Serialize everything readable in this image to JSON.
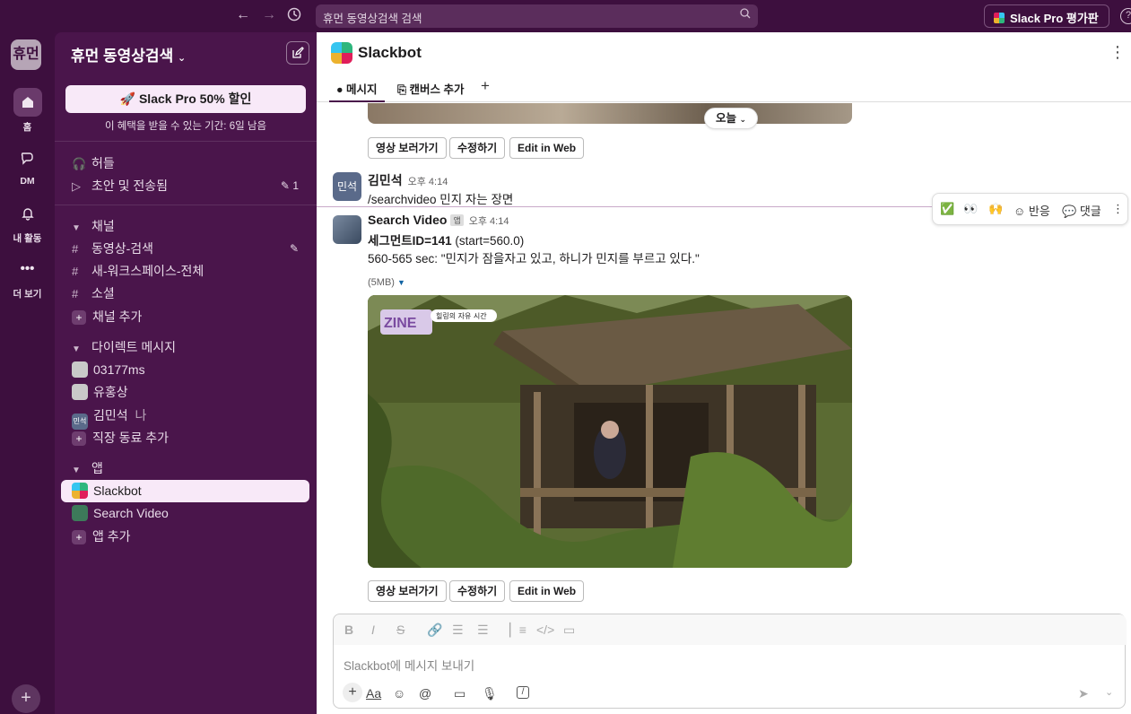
{
  "topbar": {
    "search_placeholder": "휴먼 동영상검색 검색",
    "pro_label": "Slack Pro 평가판",
    "help": "?"
  },
  "rail": {
    "workspace_initials": "휴먼",
    "items": [
      {
        "label": "홈",
        "icon": "home-icon"
      },
      {
        "label": "DM",
        "icon": "dm-icon"
      },
      {
        "label": "내 활동",
        "icon": "bell-icon"
      },
      {
        "label": "더 보기",
        "icon": "more-icon"
      }
    ]
  },
  "sidebar": {
    "workspace_name": "휴먼 동영상검색",
    "promo_label": "Slack Pro 50% 할인",
    "promo_sub": "이 혜택을 받을 수 있는 기간: 6일 남음",
    "top_items": [
      {
        "label": "허들"
      },
      {
        "label": "초안 및 전송됨",
        "badge": "1"
      }
    ],
    "channels_header": "채널",
    "channels": [
      "동영상-검색",
      "새-워크스페이스-전체",
      "소셜"
    ],
    "add_channel": "채널 추가",
    "dm_header": "다이렉트 메시지",
    "dms": [
      {
        "label": "03177ms"
      },
      {
        "label": "유홍상"
      },
      {
        "label": "김민석",
        "suffix": "나",
        "avatar_text": "민석"
      }
    ],
    "add_dm": "직장 동료 추가",
    "apps_header": "앱",
    "apps": [
      "Slackbot",
      "Search Video"
    ],
    "add_app": "앱 추가"
  },
  "channel": {
    "title": "Slackbot",
    "tabs": {
      "messages": "메시지",
      "canvas": "캔버스 추가"
    }
  },
  "messages": {
    "today": "오늘",
    "buttons": {
      "watch": "영상 보러가기",
      "edit": "수정하기",
      "web": "Edit in Web"
    },
    "m1": {
      "avatar": "민석",
      "name": "김민석",
      "time": "오후 4:14",
      "text": "/searchvideo 민지 자는 장면"
    },
    "m2": {
      "name": "Search Video",
      "badge": "앱",
      "time": "오후 4:14",
      "segment": "세그먼트ID=141",
      "start": "(start=560.0)",
      "detail": "560-565 sec: \"민지가 잠을자고 있고, 하니가 민지를 부르고 있다.\"",
      "file_size": "(5MB)",
      "video_tag": "힐링의 자유 시간",
      "video_logo": "ZINE"
    },
    "hover": {
      "react": "반응",
      "reply": "댓글"
    }
  },
  "composer": {
    "placeholder": "Slackbot에 메시지 보내기",
    "aa": "Aa"
  }
}
